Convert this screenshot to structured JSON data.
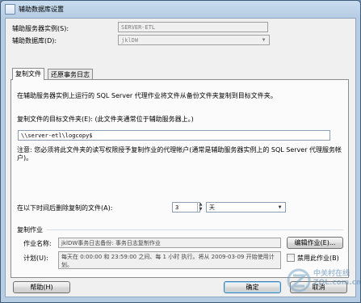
{
  "window": {
    "title": "辅助数据库设置"
  },
  "header": {
    "secondary_instance_label": "辅助服务器实例(S):",
    "secondary_instance_value": "SERVER-ETL",
    "secondary_db_label": "辅助数据库(D):",
    "secondary_db_value": "jklDW"
  },
  "tabs": [
    {
      "label": "复制文件",
      "active": true
    },
    {
      "label": "还原事务日志",
      "active": false
    }
  ],
  "copy_tab": {
    "description": "在辅助服务器实例上运行的 SQL Server 代理作业将文件从备份文件夹复制到目标文件夹。",
    "dest_folder_label": "复制文件的目标文件夹(E): (此文件夹通常位于辅助服务器上。)",
    "dest_folder_value": "\\\\server-etl\\logcopy$",
    "note": "注意: 您必须将此文件夹的读写权限授予复制作业的代理帐户(通常是辅助服务器实例上的 SQL Server 代理服务帐户)。",
    "delete_label": "在以下时间后删除复制的文件(A):",
    "delete_value": "3",
    "delete_unit": "天",
    "job_group_label": "复制作业",
    "job_name_label": "作业名称:",
    "job_name_value": "jklDW事务日志备份: 事务日志复制作业",
    "edit_job_button": "编辑作业(E)...",
    "schedule_label": "计划(U):",
    "schedule_value": "每天在 0:00:00 和 23:59:00 之间、每 1 小时 执行。将从 2009-03-09 开始使用计划。",
    "disable_job_label": "禁用此作业(B)",
    "disable_job_checked": false
  },
  "footer": {
    "help_button": "帮助(H)",
    "ok_button": "确定",
    "cancel_button": "取消"
  },
  "watermark": {
    "site_cn": "中关村在线",
    "site_en": "ZOL.com.cn"
  }
}
